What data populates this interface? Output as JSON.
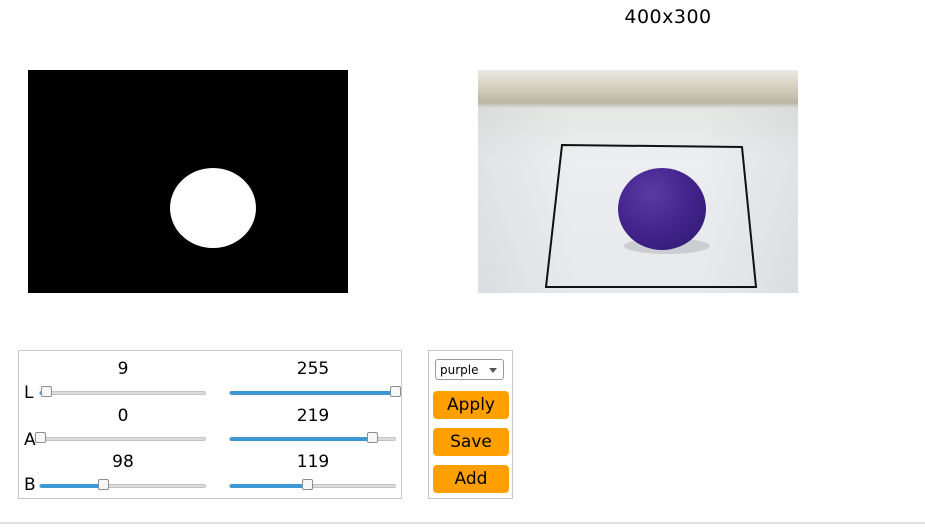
{
  "resolution_label": "400x300",
  "colors": {
    "slider_fill": "#3f98d6",
    "button_bg": "#ffa000",
    "mask_bg": "#000000"
  },
  "sliders": [
    {
      "channel": "L",
      "low": 9,
      "high": 255,
      "max": 255
    },
    {
      "channel": "A",
      "low": 0,
      "high": 219,
      "max": 255
    },
    {
      "channel": "B",
      "low": 98,
      "high": 119,
      "max": 255
    }
  ],
  "color_select": {
    "value": "purple"
  },
  "buttons": {
    "apply": "Apply",
    "save": "Save",
    "add": "Add"
  },
  "icons": {
    "dropdown": "chevron-down-icon"
  }
}
